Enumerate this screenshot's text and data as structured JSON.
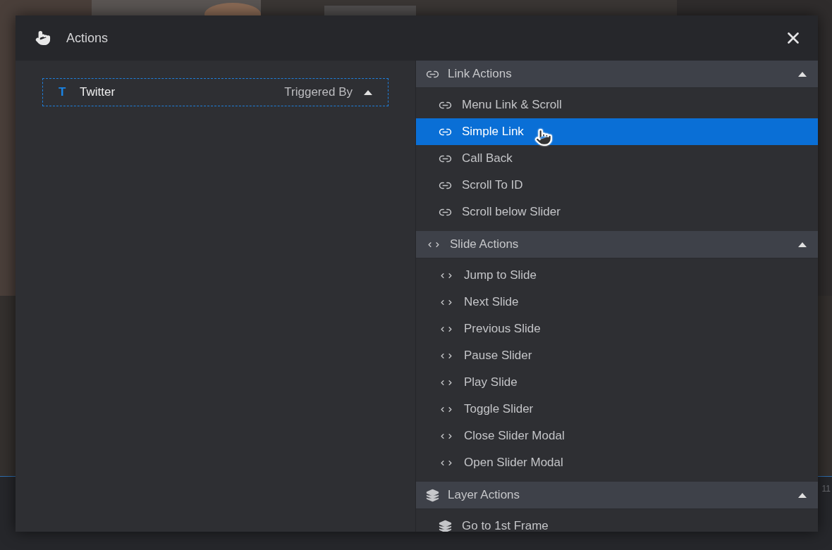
{
  "backdrop": {
    "kind": "picture",
    "ruler_label": "11"
  },
  "dialog": {
    "title": "Actions"
  },
  "layers": [
    {
      "badge": "T",
      "name": "Twitter",
      "trigger": "Triggered By",
      "selected": true,
      "expanded": true
    }
  ],
  "groups": [
    {
      "title": "Link Actions",
      "kind": "link",
      "expanded": true,
      "items": [
        {
          "label": "Menu Link & Scroll",
          "selected": false
        },
        {
          "label": "Simple Link",
          "selected": true
        },
        {
          "label": "Call Back",
          "selected": false
        },
        {
          "label": "Scroll To ID",
          "selected": false
        },
        {
          "label": "Scroll below Slider",
          "selected": false
        }
      ]
    },
    {
      "title": "Slide Actions",
      "kind": "code",
      "expanded": true,
      "items": [
        {
          "label": "Jump to Slide",
          "selected": false
        },
        {
          "label": "Next Slide",
          "selected": false
        },
        {
          "label": "Previous Slide",
          "selected": false
        },
        {
          "label": "Pause Slider",
          "selected": false
        },
        {
          "label": "Play Slide",
          "selected": false
        },
        {
          "label": "Toggle Slider",
          "selected": false
        },
        {
          "label": "Close Slider Modal",
          "selected": false
        },
        {
          "label": "Open Slider Modal",
          "selected": false
        }
      ]
    },
    {
      "title": "Layer Actions",
      "kind": "layers",
      "expanded": true,
      "items": [
        {
          "label": "Go to 1st Frame",
          "selected": false
        }
      ]
    }
  ]
}
